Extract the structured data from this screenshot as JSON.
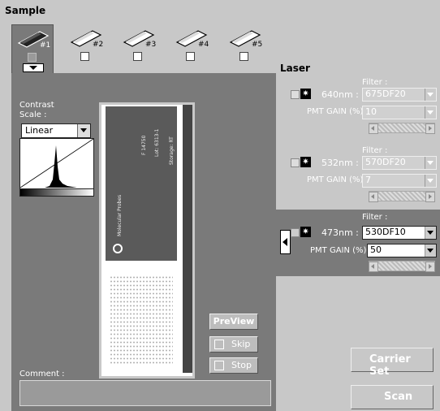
{
  "title": "Sample",
  "tabs": [
    {
      "label": "#1",
      "active": true
    },
    {
      "label": "#2",
      "active": false
    },
    {
      "label": "#3",
      "active": false
    },
    {
      "label": "#4",
      "active": false
    },
    {
      "label": "#5",
      "active": false
    }
  ],
  "contrast": {
    "label_line1": "Contrast",
    "label_line2": "Scale :",
    "scale_value": "Linear"
  },
  "buttons": {
    "preview": "PreView",
    "skip": "Skip",
    "stop": "Stop",
    "carrier_set": "Carrier Set",
    "scan": "Scan"
  },
  "comment": {
    "label": "Comment :",
    "value": ""
  },
  "laser": {
    "title": "Laser",
    "filter_label": "Filter :",
    "pmt_label": "PMT GAIN (%) :",
    "channels": [
      {
        "wavelength": "640nm :",
        "filter": "675DF20",
        "gain": "10",
        "active": false
      },
      {
        "wavelength": "532nm :",
        "filter": "570DF20",
        "gain": "7",
        "active": false
      },
      {
        "wavelength": "473nm :",
        "filter": "530DF10",
        "gain": "50",
        "active": true
      }
    ]
  },
  "icons": {
    "slide": "slide-icon",
    "laser_star": "laser-star-icon"
  }
}
